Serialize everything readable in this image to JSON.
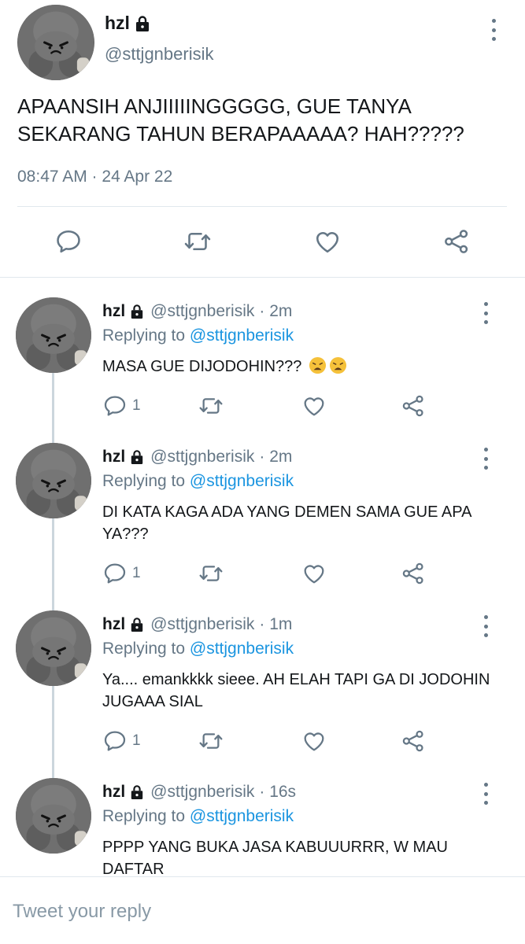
{
  "tweet": {
    "name": "hzl",
    "handle": "@sttjgnberisik",
    "text": "APAANSIH ANJIIIIINGGGGG, GUE TANYA SEKARANG TAHUN BERAPAAAAA? HAH?????",
    "timestamp": "08:47 AM · 24 Apr 22"
  },
  "replies": [
    {
      "name": "hzl",
      "handle": "@sttjgnberisik",
      "time": "· 2m",
      "replying_label": "Replying to",
      "replying_to": "@sttjgnberisik",
      "text": "MASA GUE DIJODOHIN???",
      "emoji": "weary-face x2",
      "reply_count": "1"
    },
    {
      "name": "hzl",
      "handle": "@sttjgnberisik",
      "time": "· 2m",
      "replying_label": "Replying to",
      "replying_to": "@sttjgnberisik",
      "text": "DI KATA KAGA ADA YANG DEMEN SAMA GUE APA YA???",
      "reply_count": "1"
    },
    {
      "name": "hzl",
      "handle": "@sttjgnberisik",
      "time": "· 1m",
      "replying_label": "Replying to",
      "replying_to": "@sttjgnberisik",
      "text": "Ya.... emankkkk sieee. AH ELAH TAPI GA DI JODOHIN JUGAAA SIAL",
      "reply_count": "1"
    },
    {
      "name": "hzl",
      "handle": "@sttjgnberisik",
      "time": "· 16s",
      "replying_label": "Replying to",
      "replying_to": "@sttjgnberisik",
      "text": "PPPP YANG BUKA JASA KABUUURRR, W MAU DAFTAR"
    }
  ],
  "compose": {
    "placeholder": "Tweet your reply"
  },
  "colors": {
    "text": "#14171a",
    "secondary": "#657786",
    "link": "#1b95e0",
    "divider": "#e1e8ed"
  }
}
